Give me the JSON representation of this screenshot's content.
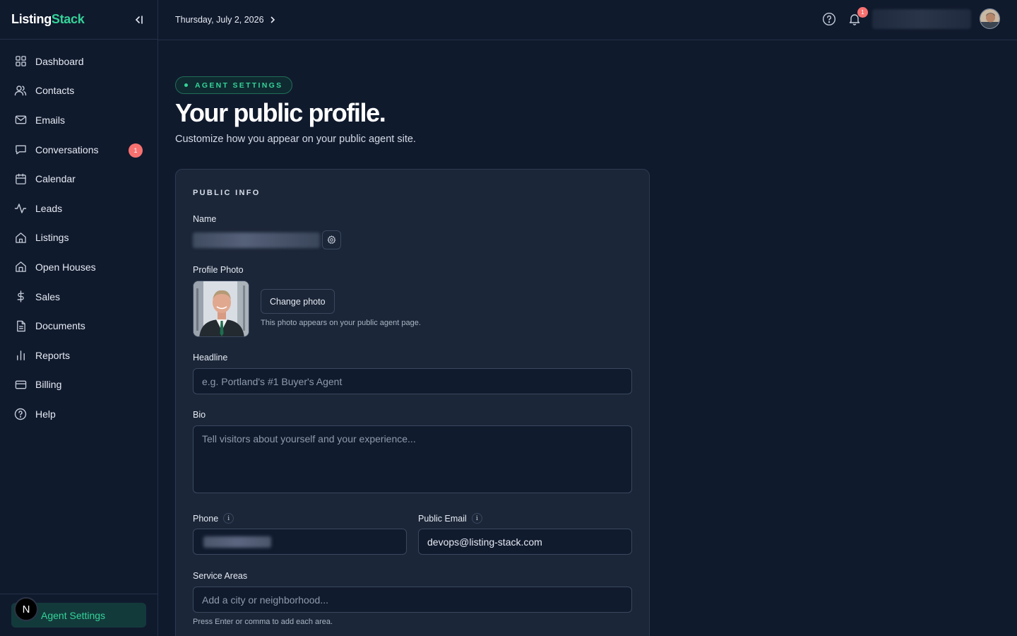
{
  "brand": {
    "part1": "Listing",
    "part2": "Stack"
  },
  "sidebar": {
    "items": [
      {
        "label": "Dashboard",
        "icon": "grid-icon"
      },
      {
        "label": "Contacts",
        "icon": "users-icon"
      },
      {
        "label": "Emails",
        "icon": "mail-icon"
      },
      {
        "label": "Conversations",
        "icon": "chat-icon",
        "badge": "1"
      },
      {
        "label": "Calendar",
        "icon": "calendar-icon"
      },
      {
        "label": "Leads",
        "icon": "activity-icon"
      },
      {
        "label": "Listings",
        "icon": "home-icon"
      },
      {
        "label": "Open Houses",
        "icon": "house-door-icon"
      },
      {
        "label": "Sales",
        "icon": "dollar-icon"
      },
      {
        "label": "Documents",
        "icon": "document-icon"
      },
      {
        "label": "Reports",
        "icon": "bar-chart-icon"
      },
      {
        "label": "Billing",
        "icon": "credit-card-icon"
      },
      {
        "label": "Help",
        "icon": "help-circle-icon"
      }
    ],
    "footer": {
      "avatar_letter": "N",
      "active_label": "Agent Settings"
    }
  },
  "topbar": {
    "date": "Thursday, July 2, 2026",
    "notification_count": "1"
  },
  "page": {
    "eyebrow": "AGENT SETTINGS",
    "title": "Your public profile.",
    "subtitle": "Customize how you appear on your public agent site."
  },
  "public_info": {
    "section_title": "PUBLIC INFO",
    "name_label": "Name",
    "photo_label": "Profile Photo",
    "change_photo": "Change photo",
    "photo_note": "This photo appears on your public agent page.",
    "headline_label": "Headline",
    "headline_placeholder": "e.g. Portland's #1 Buyer's Agent",
    "bio_label": "Bio",
    "bio_placeholder": "Tell visitors about yourself and your experience...",
    "phone_label": "Phone",
    "email_label": "Public Email",
    "email_value": "devops@listing-stack.com",
    "service_label": "Service Areas",
    "service_placeholder": "Add a city or neighborhood...",
    "service_hint": "Press Enter or comma to add each area."
  },
  "colors": {
    "accent": "#34d399",
    "badge": "#f87171",
    "background": "#101a2d",
    "card": "#1b2638"
  }
}
